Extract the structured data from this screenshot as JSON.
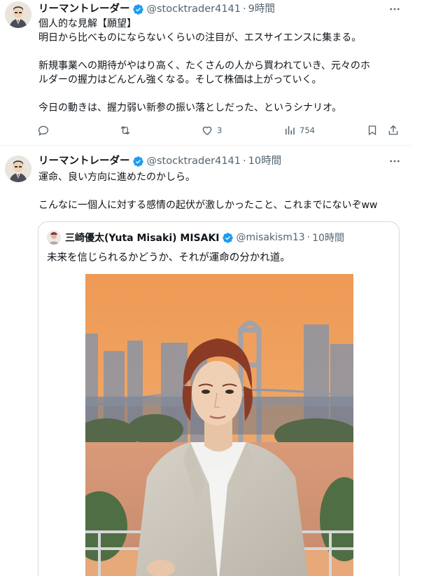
{
  "tweets": [
    {
      "author": "リーマントレーダー",
      "handle": "@stocktrader4141",
      "separator": "·",
      "time": "9時間",
      "lines": [
        "個人的な見解【願望】",
        "明日から比べものにならないくらいの注目が、エスサイエンスに集まる。",
        "",
        "新規事業への期待がやはり高く、たくさんの人から買われていき、元々のホ",
        "ルダーの握力はどんどん強くなる。そして株価は上がっていく。",
        "",
        "今日の動きは、握力弱い新参の振い落としだった、というシナリオ。"
      ],
      "actions": {
        "reply": "",
        "retweet": "",
        "like": "3",
        "views": "754"
      }
    },
    {
      "author": "リーマントレーダー",
      "handle": "@stocktrader4141",
      "separator": "·",
      "time": "10時間",
      "lines": [
        "運命、良い方向に進めたのかしら。",
        "",
        "こんなに一個人に対する感情の起伏が激しかったこと、これまでにないぞww"
      ],
      "quote": {
        "author": "三崎優太(Yuta Misaki) MISAKI",
        "handle": "@misakism13",
        "separator": "·",
        "time": "10時間",
        "text": "未来を信じられるかどうか、それが運命の分かれ道。"
      }
    }
  ],
  "colors": {
    "verified": "#1d9bf0",
    "secondary_text": "#536471",
    "divider": "#eff3f4",
    "sky": "#e8944f"
  },
  "icons": [
    "more-icon",
    "verified-icon",
    "reply-icon",
    "retweet-icon",
    "like-icon",
    "views-icon",
    "bookmark-icon",
    "share-icon"
  ]
}
